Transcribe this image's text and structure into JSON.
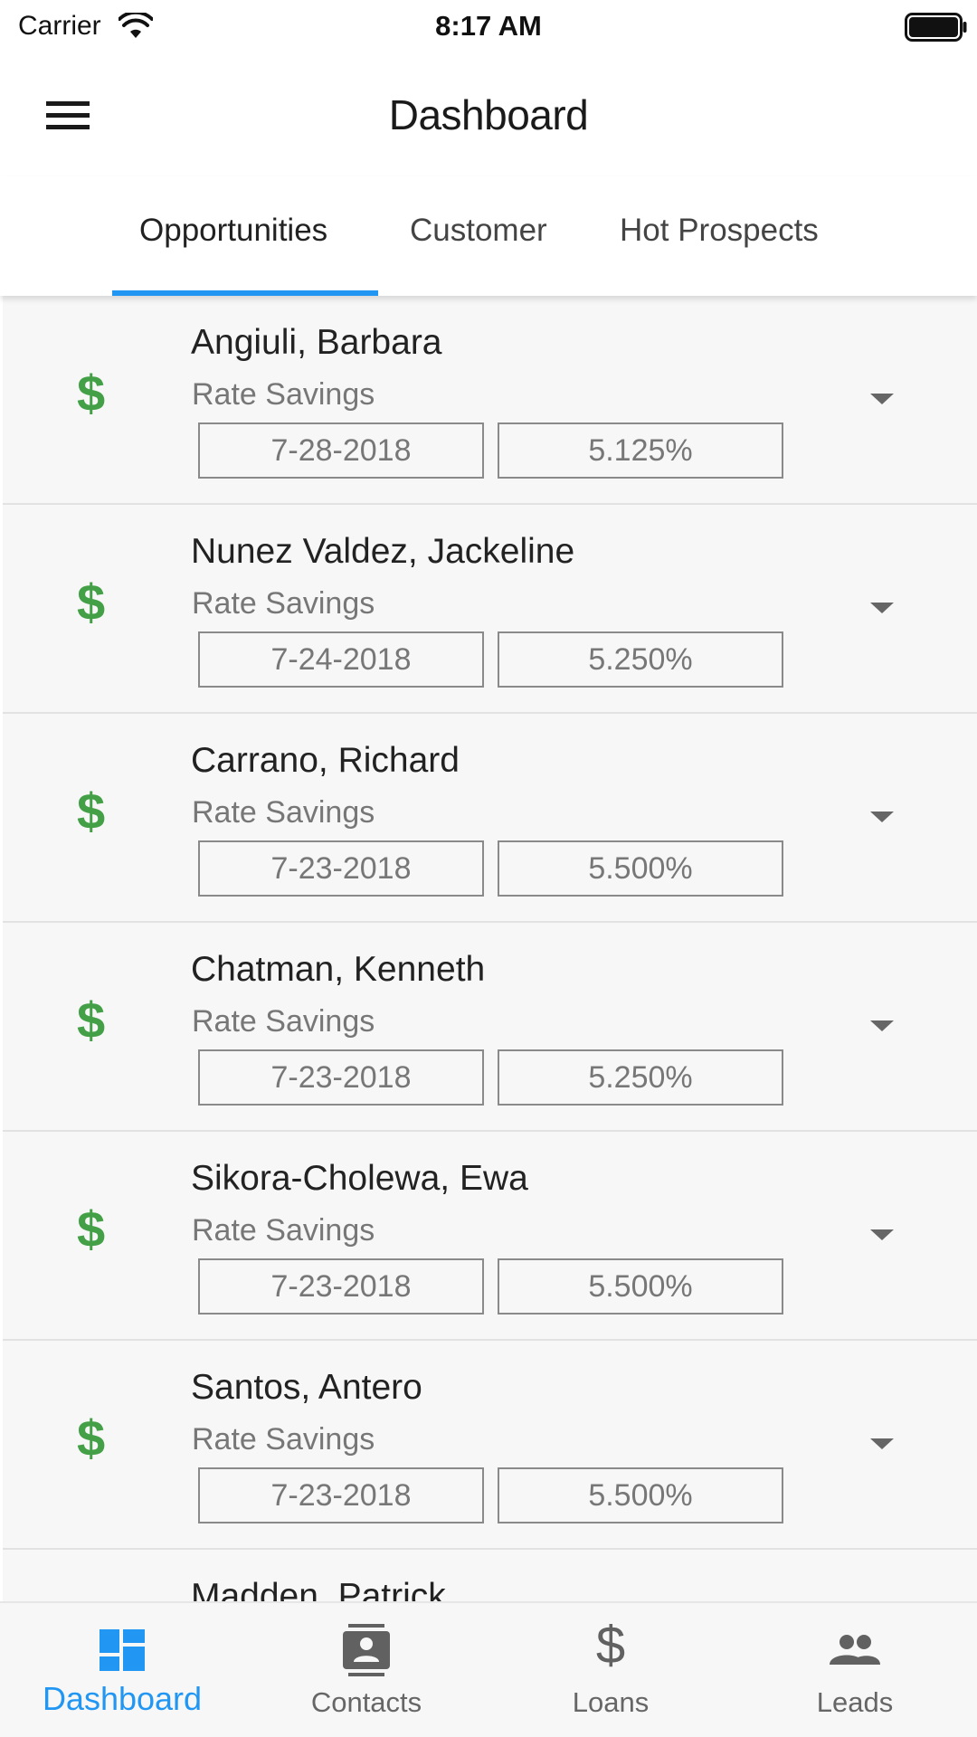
{
  "status_bar": {
    "carrier": "Carrier",
    "time": "8:17 AM"
  },
  "app_bar": {
    "title": "Dashboard"
  },
  "tabs": [
    {
      "label": "Opportunities",
      "active": true
    },
    {
      "label": "Customer",
      "active": false
    },
    {
      "label": "Hot Prospects",
      "active": false
    }
  ],
  "colors": {
    "accent": "#2196f3",
    "dollar_icon": "#43a047"
  },
  "icons": {
    "row": "dollar-icon",
    "expand": "caret-down-icon"
  },
  "opportunities": [
    {
      "name": "Angiuli, Barbara",
      "type": "Rate Savings",
      "date": "7-28-2018",
      "rate": "5.125%"
    },
    {
      "name": "Nunez Valdez, Jackeline",
      "type": "Rate Savings",
      "date": "7-24-2018",
      "rate": "5.250%"
    },
    {
      "name": "Carrano, Richard",
      "type": "Rate Savings",
      "date": "7-23-2018",
      "rate": "5.500%"
    },
    {
      "name": "Chatman, Kenneth",
      "type": "Rate Savings",
      "date": "7-23-2018",
      "rate": "5.250%"
    },
    {
      "name": "Sikora-Cholewa, Ewa",
      "type": "Rate Savings",
      "date": "7-23-2018",
      "rate": "5.500%"
    },
    {
      "name": "Santos, Antero",
      "type": "Rate Savings",
      "date": "7-23-2018",
      "rate": "5.500%"
    },
    {
      "name": "Madden, Patrick"
    }
  ],
  "bottom_nav": [
    {
      "label": "Dashboard",
      "icon": "dashboard-icon",
      "active": true
    },
    {
      "label": "Contacts",
      "icon": "contacts-icon",
      "active": false
    },
    {
      "label": "Loans",
      "icon": "dollar-icon",
      "active": false
    },
    {
      "label": "Leads",
      "icon": "people-icon",
      "active": false
    }
  ]
}
